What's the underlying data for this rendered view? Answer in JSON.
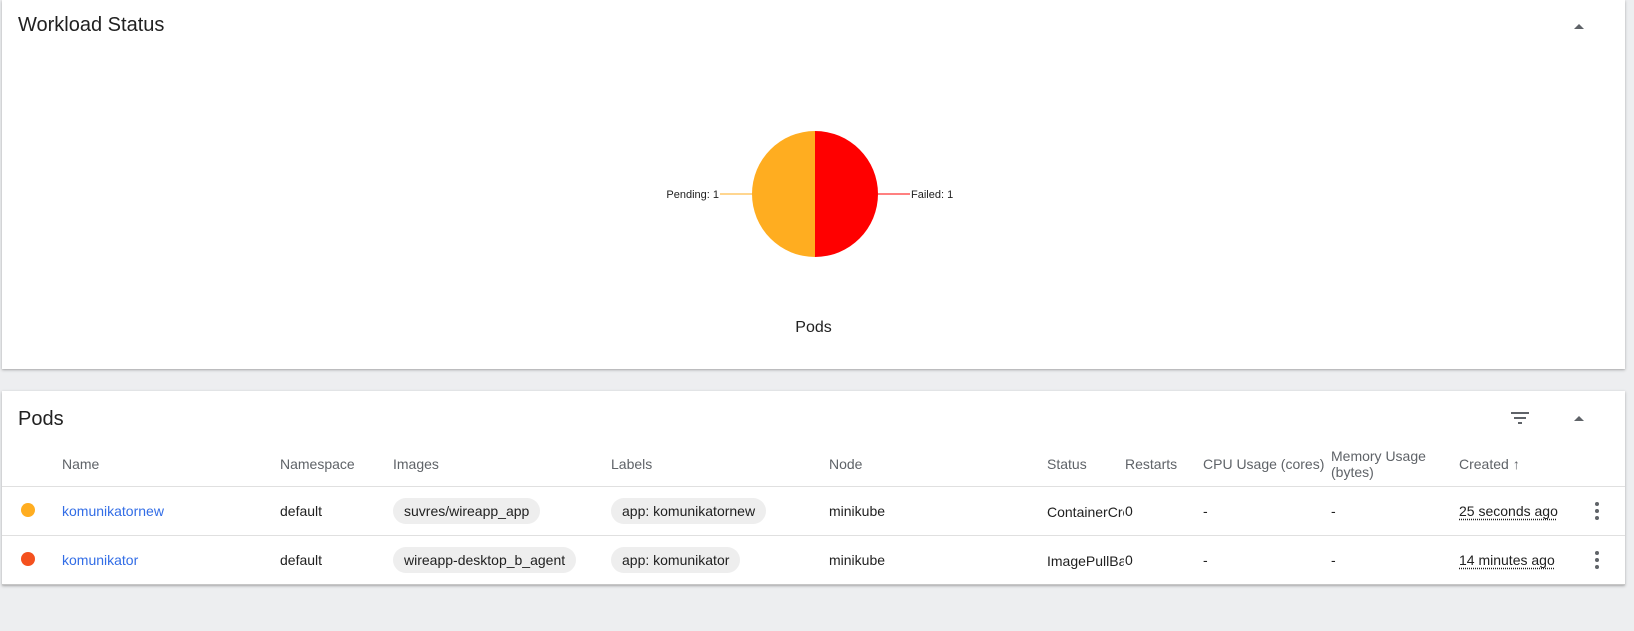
{
  "workload": {
    "title": "Workload Status",
    "chart_title": "Pods"
  },
  "chart_data": {
    "type": "pie",
    "title": "Pods",
    "slices": [
      {
        "label": "Failed: 1",
        "name": "Failed",
        "value": 1,
        "color": "#ff0000"
      },
      {
        "label": "Pending: 1",
        "name": "Pending",
        "value": 1,
        "color": "#ffad20"
      }
    ]
  },
  "pods": {
    "title": "Pods",
    "columns": {
      "name": "Name",
      "namespace": "Namespace",
      "images": "Images",
      "labels": "Labels",
      "node": "Node",
      "status": "Status",
      "restarts": "Restarts",
      "cpu": "CPU Usage (cores)",
      "memory_line1": "Memory Usage",
      "memory_line2": "(bytes)",
      "created": "Created",
      "created_sort": "↑"
    },
    "rows": [
      {
        "status_color": "#ffad20",
        "name": "komunikatornew",
        "namespace": "default",
        "image": "suvres/wireapp_app",
        "label": "app: komunikatornew",
        "node": "minikube",
        "status": "ContainerCreating",
        "restarts": "0",
        "cpu": "-",
        "memory": "-",
        "created": "25 seconds ago"
      },
      {
        "status_color": "#f4511e",
        "name": "komunikator",
        "namespace": "default",
        "image": "wireapp-desktop_b_agent",
        "label": "app: komunikator",
        "node": "minikube",
        "status": "ImagePullBackOff",
        "restarts": "0",
        "cpu": "-",
        "memory": "-",
        "created": "14 minutes ago"
      }
    ]
  },
  "icons": {
    "collapse": "chevron-up-icon",
    "filter": "filter-icon",
    "more": "more-vert-icon"
  }
}
